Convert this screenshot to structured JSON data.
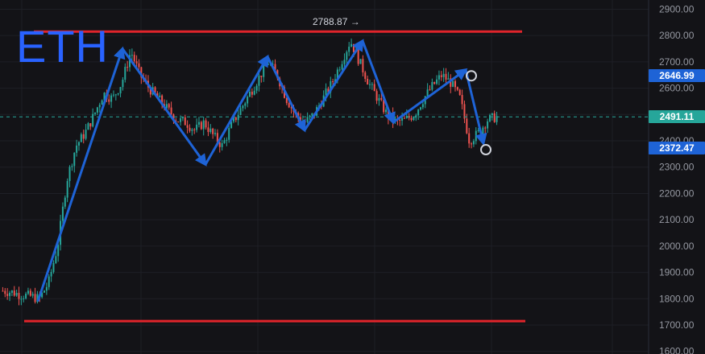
{
  "chart_data": {
    "type": "candlestick",
    "title": "ETH",
    "y_axis": {
      "ticks": [
        1600,
        1700,
        1800,
        1900,
        2000,
        2100,
        2200,
        2300,
        2400,
        2500,
        2600,
        2700,
        2800,
        2900
      ],
      "ylim": [
        1590,
        2935
      ]
    },
    "annotations": {
      "peak": {
        "value": 2788.87,
        "label": "2788.87 →"
      },
      "resistance": 2815,
      "support": 1715,
      "current_price": "2491.11",
      "upper_marker": "2646.99",
      "lower_marker": "2372.47"
    },
    "zigzag": [
      1790,
      2750,
      2310,
      2720,
      2440,
      2780,
      2470,
      2670,
      2390
    ],
    "trend_path": [
      1830,
      1825,
      1815,
      1810,
      1800,
      1860,
      2000,
      2250,
      2380,
      2430,
      2500,
      2580,
      2560,
      2620,
      2740,
      2650,
      2600,
      2560,
      2520,
      2480,
      2470,
      2440,
      2470,
      2420,
      2380,
      2460,
      2520,
      2580,
      2640,
      2700,
      2650,
      2560,
      2500,
      2470,
      2500,
      2560,
      2620,
      2700,
      2780,
      2700,
      2620,
      2560,
      2500,
      2470,
      2480,
      2500,
      2560,
      2610,
      2650,
      2620,
      2560,
      2400,
      2430,
      2480,
      2491
    ],
    "colors": {
      "up": "#26a69a",
      "down": "#ef5350",
      "level": "#e0242b",
      "zigzag": "#1e63d6",
      "badge_blue": "#1e63d6",
      "badge_teal": "#26a69a"
    }
  }
}
